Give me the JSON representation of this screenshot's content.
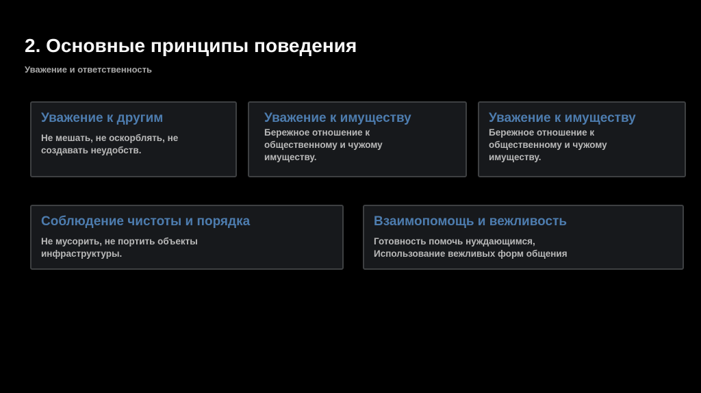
{
  "slide": {
    "title": "2. Основные принципы поведения",
    "subtitle": "Уважение и ответственность",
    "cards": [
      {
        "heading": "Уважение к другим",
        "body": "Не мешать, не оскорблять, не\nсоздавать неудобств."
      },
      {
        "heading": "Уважение к имуществу",
        "body": "Бережное отношение к\nобщественному и чужому\nимуществу."
      },
      {
        "heading": "Уважение к имуществу",
        "body": "Бережное отношение к\nобщественному и чужому\nимуществу."
      },
      {
        "heading": "Соблюдение чистоты и порядка",
        "body": "Не мусорить, не портить объекты\nинфраструктуры."
      },
      {
        "heading": "Взаимопомощь и вежливость",
        "body": "Готовность помочь нуждающимся,\nИспользование вежливых форм общения"
      }
    ],
    "colors": {
      "background": "#000000",
      "card_background": "#17191c",
      "card_border": "#3e4042",
      "heading_accent": "#4d7cae",
      "body_text": "#b9b9b9",
      "title_text": "#f8f8f8",
      "subtitle_text": "#a9a9a9"
    }
  }
}
